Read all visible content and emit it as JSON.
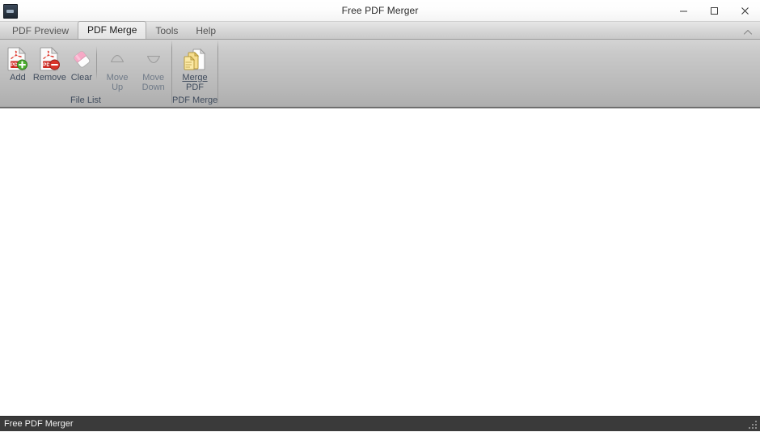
{
  "window": {
    "title": "Free PDF Merger",
    "app_icon_name": "app-icon",
    "controls": {
      "minimize_label": "Minimize",
      "maximize_label": "Maximize",
      "close_label": "Close"
    }
  },
  "tabs": [
    {
      "label": "PDF Preview",
      "active": false
    },
    {
      "label": "PDF Merge",
      "active": true
    },
    {
      "label": "Tools",
      "active": false
    },
    {
      "label": "Help",
      "active": false
    }
  ],
  "ribbon": {
    "collapse_icon": "chevron-up-icon",
    "groups": [
      {
        "label": "File List",
        "buttons": [
          {
            "name": "add",
            "label": "Add",
            "icon": "pdf-add-icon",
            "disabled": false
          },
          {
            "name": "remove",
            "label": "Remove",
            "icon": "pdf-remove-icon",
            "disabled": false
          },
          {
            "name": "clear",
            "label": "Clear",
            "icon": "eraser-icon",
            "disabled": false
          },
          {
            "name": "move-up",
            "label_line1": "Move",
            "label_line2": "Up",
            "icon": "triangle-up-icon",
            "disabled": true
          },
          {
            "name": "move-down",
            "label_line1": "Move",
            "label_line2": "Down",
            "icon": "triangle-down-icon",
            "disabled": true
          }
        ]
      },
      {
        "label": "PDF Merge",
        "buttons": [
          {
            "name": "merge-pdf",
            "label_line1": "Merge",
            "label_line2": "PDF",
            "icon": "stacked-pages-icon",
            "disabled": false
          }
        ]
      }
    ]
  },
  "file_list": {
    "items": [],
    "empty": true
  },
  "status_bar": {
    "text": "Free PDF Merger",
    "grip_icon": "resize-grip-icon"
  },
  "colors": {
    "titlebar_bg": "#fdfdfd",
    "ribbon_top": "#d4d4d4",
    "ribbon_bottom": "#aeaeae",
    "label_text": "#3f4b5c",
    "statusbar_bg": "#3a3a3a",
    "statusbar_text": "#f0f0f0",
    "content_bg": "#ffffff",
    "accent_green": "#49a83c",
    "accent_red": "#d33a2e"
  }
}
